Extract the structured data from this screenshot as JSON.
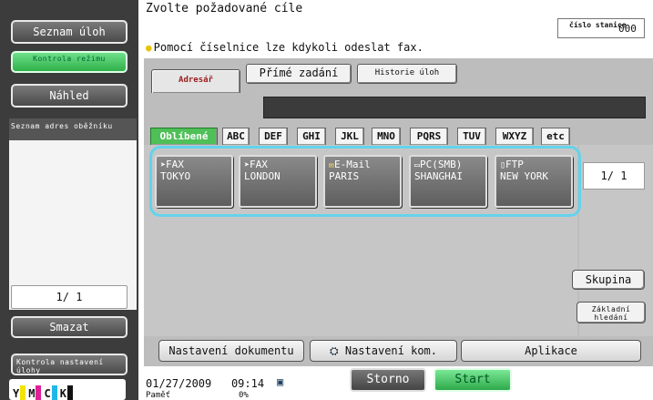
{
  "left": {
    "task_list": "Seznam úloh",
    "mode_check": "Kontrola režimu",
    "preview": "Náhled",
    "broadcast_list_title": "Seznam adres oběžníku",
    "page": "1/ 1",
    "delete": "Smazat",
    "job_settings_check": "Kontrola nastavení úlohy",
    "toner": [
      "Y",
      "M",
      "C",
      "K"
    ]
  },
  "header": {
    "title": "Zvolte požadované cíle",
    "station_label": "číslo stanice",
    "station_value": "000",
    "hint": "Pomocí číselnice lze kdykoli odeslat fax."
  },
  "tabs": [
    {
      "label": "Adresář",
      "active": true
    },
    {
      "label": "Přímé zadání",
      "active": false
    },
    {
      "label": "Historie úloh",
      "active": false
    }
  ],
  "index_tabs": [
    "Oblíbené",
    "ABC",
    "DEF",
    "GHI",
    "JKL",
    "MNO",
    "PQRS",
    "TUV",
    "WXYZ",
    "etc"
  ],
  "destinations": [
    {
      "icon": "fax-icon",
      "type": "FAX",
      "name": "TOKYO"
    },
    {
      "icon": "fax-icon",
      "type": "FAX",
      "name": "LONDON"
    },
    {
      "icon": "email-icon",
      "type": "E-Mail",
      "name": "PARIS"
    },
    {
      "icon": "pc-icon",
      "type": "PC(SMB)",
      "name": "SHANGHAI"
    },
    {
      "icon": "ftp-icon",
      "type": "FTP",
      "name": "NEW YORK"
    }
  ],
  "right": {
    "page": "1/ 1",
    "group": "Skupina",
    "basic_search": "Základní hledání"
  },
  "bottom": {
    "doc_settings": "Nastavení dokumentu",
    "comm_settings": "Nastavení kom.",
    "application": "Aplikace"
  },
  "status": {
    "date": "01/27/2009",
    "time": "09:14",
    "memory_label": "Paměť",
    "memory_value": "0%",
    "stop": "Storno",
    "start": "Start"
  },
  "colors": {
    "accent_green": "#4fbf58",
    "selection_frame": "#63d3ec"
  }
}
